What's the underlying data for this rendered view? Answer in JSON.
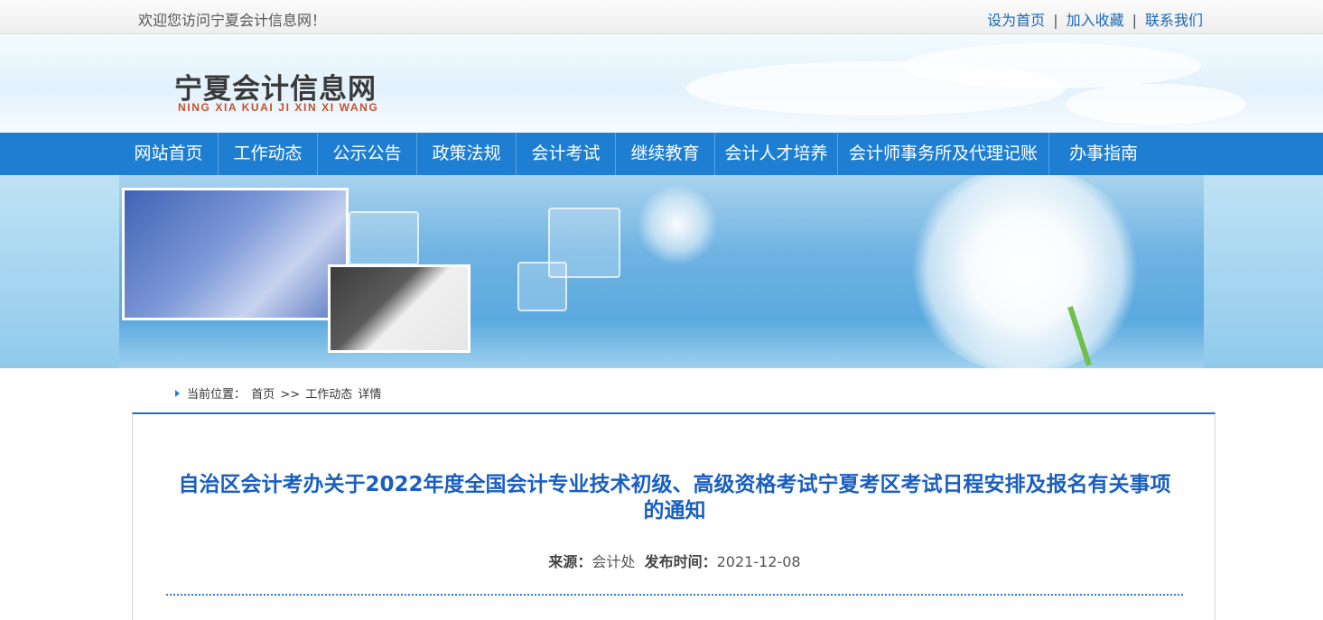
{
  "topbar": {
    "welcome": "欢迎您访问宁夏会计信息网！",
    "links": [
      "设为首页",
      "加入收藏",
      "联系我们"
    ],
    "separator": "|"
  },
  "logo": {
    "cn": "宁夏会计信息网",
    "en": "NING XIA KUAI JI XIN XI WANG"
  },
  "nav": {
    "items": [
      "网站首页",
      "工作动态",
      "公示公告",
      "政策法规",
      "会计考试",
      "继续教育",
      "会计人才培养",
      "会计师事务所及代理记账",
      "办事指南"
    ]
  },
  "breadcrumb": {
    "label": "当前位置：",
    "home": "首页",
    "sep": ">>",
    "section": "工作动态",
    "page": "详情"
  },
  "article": {
    "title": "自治区会计考办关于2022年度全国会计专业技术初级、高级资格考试宁夏考区考试日程安排及报名有关事项的通知",
    "source_label": "来源：",
    "source": "会计处",
    "date_label": "发布时间：",
    "date": "2021-12-08"
  },
  "colors": {
    "nav_bg": "#1e7fd2",
    "title": "#1a5fc0",
    "link": "#1a68b5",
    "logo_en": "#c9502b"
  }
}
